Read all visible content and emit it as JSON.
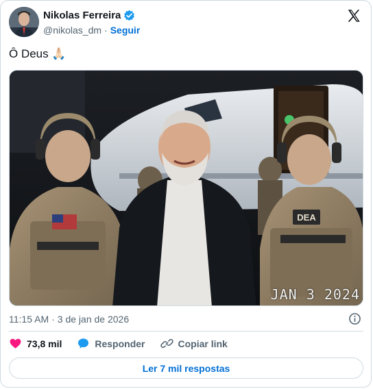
{
  "author": {
    "name": "Nikolas Ferreira",
    "handle": "@nikolas_dm",
    "separator": "·",
    "follow_label": "Seguir"
  },
  "tweet": {
    "text": "Ô Deus 🙏🏻",
    "media_timestamp": "JAN  3 2024",
    "patch_text": "DEA",
    "time": "11:15 AM",
    "date": "3 de jan de 2026"
  },
  "actions": {
    "likes": "73,8 mil",
    "reply_label": "Responder",
    "copy_label": "Copiar link",
    "read_replies_label": "Ler 7 mil respostas"
  },
  "colors": {
    "link": "#006fd6",
    "heart": "#f91880",
    "verified": "#1d9bf0",
    "reply_icon": "#1d9bf0"
  },
  "icons": [
    "verified-badge-icon",
    "x-logo-icon",
    "info-icon",
    "heart-icon",
    "reply-bubble-icon",
    "link-icon"
  ]
}
